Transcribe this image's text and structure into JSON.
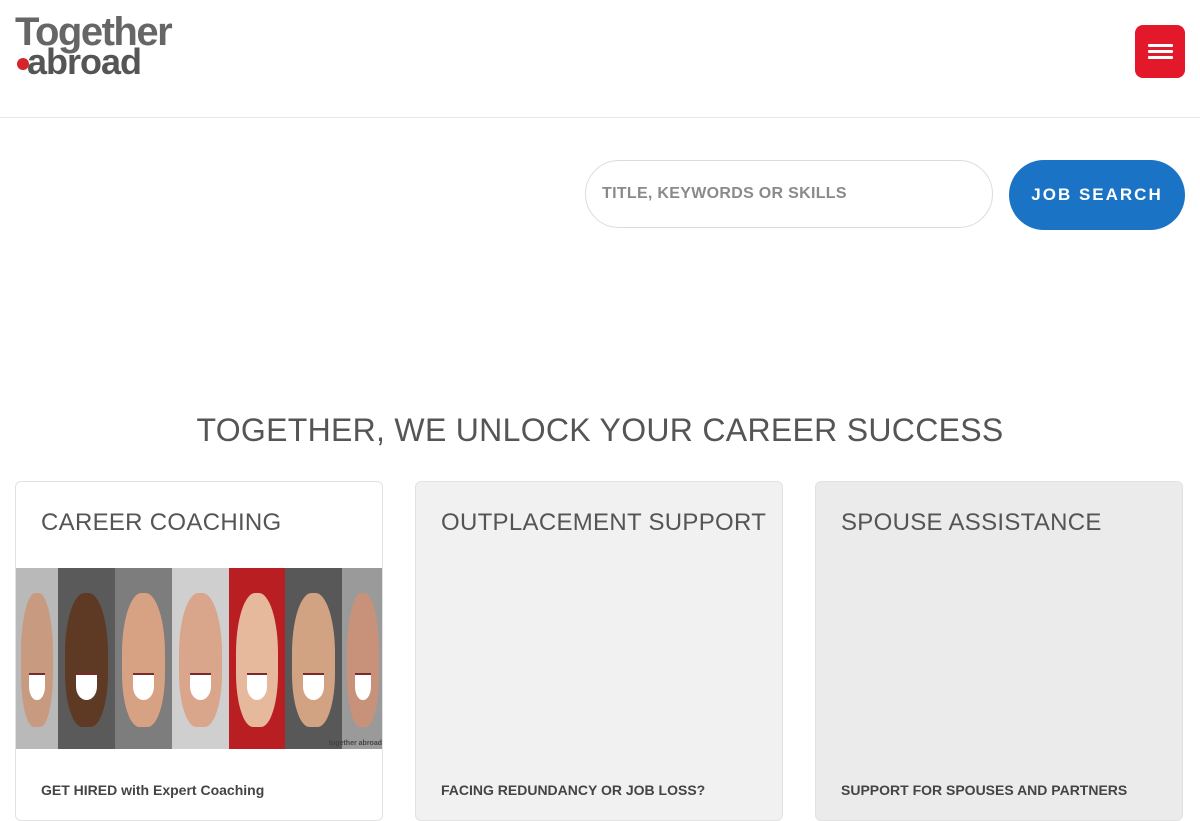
{
  "header": {
    "logo": {
      "line1": "Together",
      "line2": "abroad"
    },
    "menu_icon": "hamburger-menu-icon",
    "brand_red": "#e3182b"
  },
  "search": {
    "placeholder": "TITLE, KEYWORDS OR SKILLS",
    "button_label": "JOB SEARCH",
    "button_color": "#1a73c4"
  },
  "headline": "TOGETHER, WE UNLOCK YOUR CAREER SUCCESS",
  "cards": [
    {
      "title": "CAREER COACHING",
      "subtitle": "GET HIRED with Expert Coaching"
    },
    {
      "title": "OUTPLACEMENT SUPPORT",
      "subtitle": "FACING REDUNDANCY OR JOB LOSS?"
    },
    {
      "title": "SPOUSE ASSISTANCE",
      "subtitle": "SUPPORT FOR SPOUSES AND PARTNERS"
    }
  ],
  "photo_watermark": "together abroad"
}
